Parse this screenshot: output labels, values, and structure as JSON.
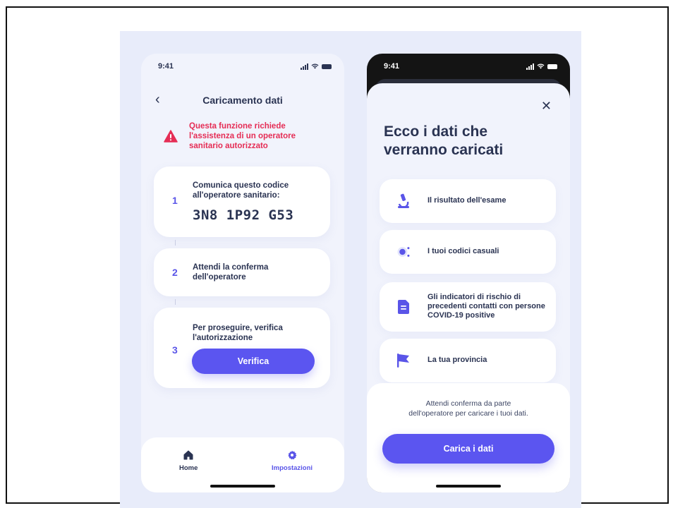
{
  "left_phone": {
    "status_time": "9:41",
    "nav": {
      "back_glyph": "‹",
      "title": "Caricamento dati"
    },
    "warning": {
      "text": "Questa funzione richiede l'assistenza di un operatore sanitario autorizzato"
    },
    "steps": [
      {
        "number": "1",
        "text": "Comunica questo codice all'operatore sanitario:",
        "code": "3N8 1P92 G53"
      },
      {
        "number": "2",
        "text": "Attendi la conferma dell'operatore"
      },
      {
        "number": "3",
        "text": "Per proseguire, verifica l'autorizzazione",
        "button_label": "Verifica"
      }
    ],
    "tabbar": [
      {
        "label": "Home",
        "icon": "home-icon"
      },
      {
        "label": "Impostazioni",
        "icon": "gear-icon"
      }
    ]
  },
  "right_phone": {
    "status_time": "9:41",
    "close_glyph": "✕",
    "title": "Ecco i dati che verranno caricati",
    "items": [
      {
        "label": "Il risultato dell'esame",
        "icon": "microscope-icon"
      },
      {
        "label": "I tuoi codici casuali",
        "icon": "random-codes-icon"
      },
      {
        "label": "Gli indicatori di rischio di precedenti contatti con persone COVID-19 positive",
        "icon": "document-icon"
      },
      {
        "label": "La tua provincia",
        "icon": "flag-icon"
      }
    ],
    "info_text_line1": "Attendi conferma da parte",
    "info_text_line2": "dell'operatore per caricare i tuoi dati.",
    "upload_button_label": "Carica i dati"
  },
  "colors": {
    "accent": "#5b55f0",
    "warning": "#e52d55",
    "text": "#2a3352",
    "background": "#e8ecfa"
  }
}
